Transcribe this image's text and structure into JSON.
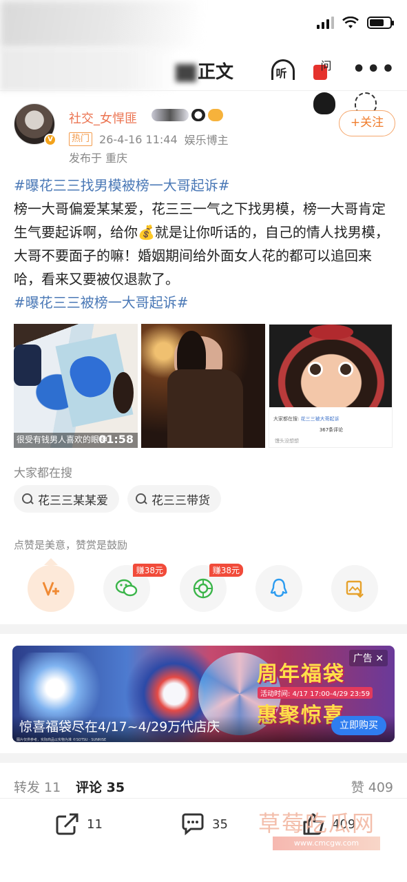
{
  "status_bar": {
    "icons": [
      "signal-icon",
      "wifi-icon",
      "battery-icon"
    ]
  },
  "nav": {
    "title": "正文",
    "listen_label": "听",
    "redpack_label": "问",
    "more_label": "•••"
  },
  "author": {
    "name": "社交_女悍匪",
    "hot_label": "热门",
    "time": "26-4-16 11:44",
    "role": "娱乐博主",
    "location": "发布于 重庆",
    "follow_label": "+关注",
    "verified_icon": "v-badge-icon"
  },
  "post": {
    "tag1": "#曝花三三找男模被榜一大哥起诉#",
    "text_before_emoji": "榜一大哥偏爱某某爱，花三三一气之下找男模，榜一大哥肯定生气要起诉啊，给你",
    "emoji": "💰",
    "text_after_emoji": "就是让你听话的，自己的情人找男模，大哥不要面子的嘛！婚姻期间给外面女人花的都可以追回来哈，看来又要被仅退款了。",
    "tag2": "#曝花三三被榜一大哥起诉#"
  },
  "images": {
    "video_subtitle": "很受有钱男人喜欢的眼神",
    "video_duration": "01:58",
    "pic3_prefix": "大家都在搜:",
    "pic3_search": "花三三被大哥起诉",
    "pic3_count": "367条评论",
    "pic3_user": "馒头没想想"
  },
  "search": {
    "title": "大家都在搜",
    "chips": [
      "花三三某某爱",
      "花三三带货"
    ]
  },
  "reward": {
    "note": "点赞是美意，赞赏是鼓励",
    "earn_wechat": "赚38元",
    "earn_moments": "赚38元"
  },
  "ad": {
    "tag": "广告 ✕",
    "headline1": "周年福袋",
    "date": "活动时间: 4/17 17:00-4/29 23:59",
    "headline2": "惠聚惊喜",
    "caption": "惊喜福袋尽在4/17~4/29万代店庆",
    "button": "立即购买",
    "footnote": "图片仅供参考，实际商品以实物为准 ©SOTSU · SUNRISE"
  },
  "tabs": {
    "forward": "转发 11",
    "comment": "评论 35",
    "like": "赞 409"
  },
  "bottom": {
    "forward_count": "11",
    "comment_count": "35",
    "like_count": "409"
  },
  "watermark": {
    "text": "草莓吃瓜网",
    "url": "www.cmcgw.com"
  },
  "colors": {
    "accent": "#eb7350",
    "tag": "#4a78b6",
    "ad_button": "#2f7df0",
    "earn_badge": "#f14b3a"
  }
}
